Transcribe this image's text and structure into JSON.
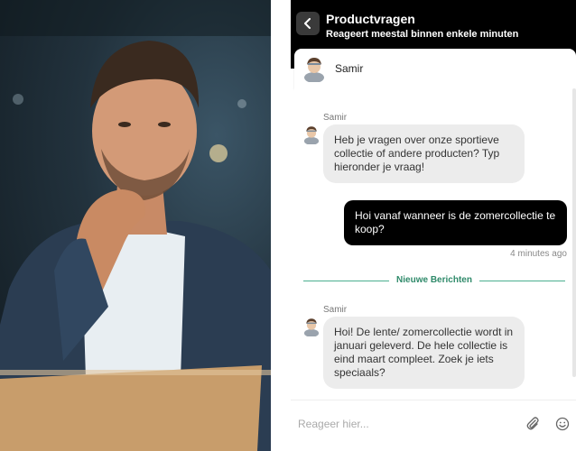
{
  "header": {
    "title": "Productvragen",
    "subtitle": "Reageert meestal binnen enkele minuten"
  },
  "agent": {
    "name": "Samir"
  },
  "messages": [
    {
      "sender": "Samir",
      "direction": "incoming",
      "text": "Heb je vragen over onze sportieve collectie of andere producten? Typ hieronder je vraag!"
    },
    {
      "direction": "outgoing",
      "text": "Hoi vanaf wanneer is de zomercollectie te koop?",
      "time": "4 minutes ago"
    },
    {
      "sender": "Samir",
      "direction": "incoming",
      "text": "Hoi! De lente/ zomercollectie wordt in januari geleverd. De hele collectie is eind maart compleet. Zoek je iets speciaals?"
    }
  ],
  "divider_label": "Nieuwe Berichten",
  "composer": {
    "placeholder": "Reageer hier..."
  },
  "icons": {
    "back": "chevron-left-icon",
    "attach": "paperclip-icon",
    "emoji": "smiley-icon"
  },
  "colors": {
    "header_bg": "#000000",
    "incoming_bubble": "#ececec",
    "outgoing_bubble": "#000000",
    "divider_accent": "#2f8a6a"
  }
}
